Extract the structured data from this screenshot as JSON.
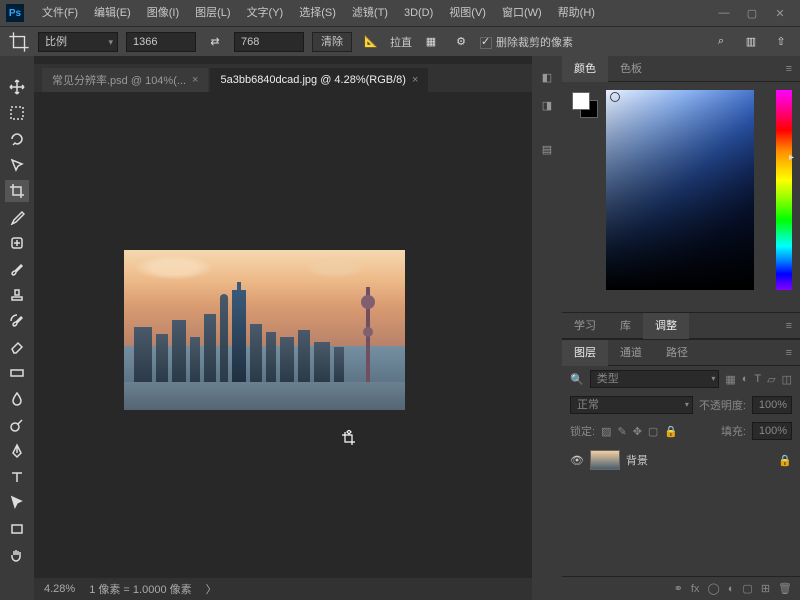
{
  "menu": {
    "items": [
      "文件(F)",
      "编辑(E)",
      "图像(I)",
      "图层(L)",
      "文字(Y)",
      "选择(S)",
      "滤镜(T)",
      "3D(D)",
      "视图(V)",
      "窗口(W)",
      "帮助(H)"
    ]
  },
  "optbar": {
    "ratio_label": "比例",
    "width": "1366",
    "height": "768",
    "clear": "清除",
    "straighten": "拉直",
    "delete_cropped": "删除裁剪的像素"
  },
  "tabs": [
    {
      "label": "常见分辨率.psd @ 104%(...",
      "active": false
    },
    {
      "label": "5a3bb6840dcad.jpg @ 4.28%(RGB/8)",
      "active": true
    }
  ],
  "status": {
    "zoom": "4.28%",
    "pixel": "1 像素 = 1.0000 像素"
  },
  "panels": {
    "color_tabs": [
      "颜色",
      "色板"
    ],
    "adjust_tabs": [
      "学习",
      "库",
      "调整"
    ],
    "layer_tabs": [
      "图层",
      "通道",
      "路径"
    ],
    "type_label": "类型",
    "blend_mode": "正常",
    "opacity_label": "不透明度:",
    "opacity_value": "100%",
    "lock_label": "锁定:",
    "fill_label": "填充:",
    "fill_value": "100%",
    "layer_name": "背景"
  }
}
